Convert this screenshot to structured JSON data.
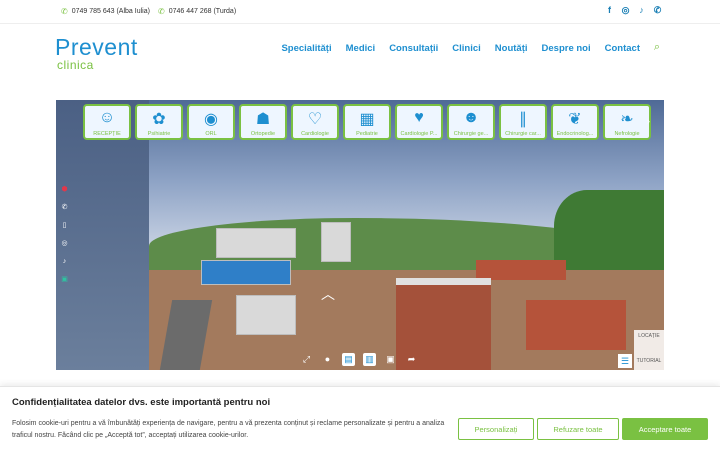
{
  "topbar": {
    "phone1": "0749 785 643 (Alba Iulia)",
    "phone2": "0746 447 268 (Turda)",
    "social": [
      {
        "icon": "facebook-icon",
        "glyph": "f"
      },
      {
        "icon": "instagram-icon",
        "glyph": "◎"
      },
      {
        "icon": "tiktok-icon",
        "glyph": "♪"
      },
      {
        "icon": "whatsapp-icon",
        "glyph": "✆"
      }
    ]
  },
  "logo": {
    "main": "Prevent",
    "sub": "clinica"
  },
  "nav": {
    "items": [
      "Specialități",
      "Medici",
      "Consultații",
      "Clinici",
      "Noutăți",
      "Despre noi",
      "Contact"
    ]
  },
  "tour": {
    "thumbs": [
      {
        "label": "RECEPȚIE",
        "glyph": "☺"
      },
      {
        "label": "Psihiatrie",
        "glyph": "✿"
      },
      {
        "label": "ORL",
        "glyph": "◉"
      },
      {
        "label": "Ortopedie",
        "glyph": "☗"
      },
      {
        "label": "Cardiologie",
        "glyph": "♡"
      },
      {
        "label": "Pediatrie",
        "glyph": "▦"
      },
      {
        "label": "Cardiologie P...",
        "glyph": "♥"
      },
      {
        "label": "Chirurgie ge...",
        "glyph": "☻"
      },
      {
        "label": "Chirurgie car...",
        "glyph": "∥"
      },
      {
        "label": "Endocrinolog...",
        "glyph": "❦"
      },
      {
        "label": "Nefrologie",
        "glyph": "❧"
      }
    ],
    "location_label": "LOCAȚIE",
    "tutorial_label": "TUTORIAL"
  },
  "colors": {
    "brand_blue": "#1e8fd0",
    "brand_green": "#7ac142"
  },
  "cookie": {
    "title": "Confidențialitatea datelor dvs. este importantă pentru noi",
    "text": "Folosim cookie-uri pentru a vă îmbunătăți experiența de navigare, pentru a vă prezenta conținut și reclame personalizate și pentru a analiza traficul nostru. Făcând clic pe „Acceptă tot”, acceptați utilizarea cookie-urilor.",
    "customize": "Personalizați",
    "reject": "Refuzare toate",
    "accept": "Acceptare toate"
  }
}
